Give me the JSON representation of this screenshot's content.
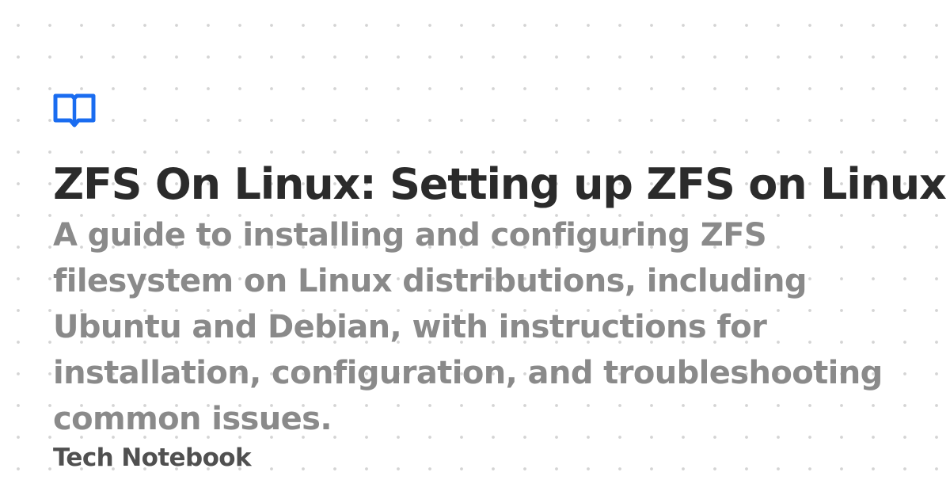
{
  "page": {
    "title": "ZFS On Linux: Setting up ZFS on Linux",
    "description": "A guide to installing and configuring ZFS filesystem on Linux distributions, including Ubuntu and Debian, with instructions for installation, configuration, and troubleshooting common issues.",
    "site_name": "Tech Notebook"
  },
  "icons": {
    "logo": "open-book-icon"
  },
  "colors": {
    "background": "#ffffff",
    "dots": "#d4d4d4",
    "accent": "#1a6cf0",
    "title": "#2b2b2b",
    "description": "#8a8a8a",
    "site_name": "#505050"
  }
}
